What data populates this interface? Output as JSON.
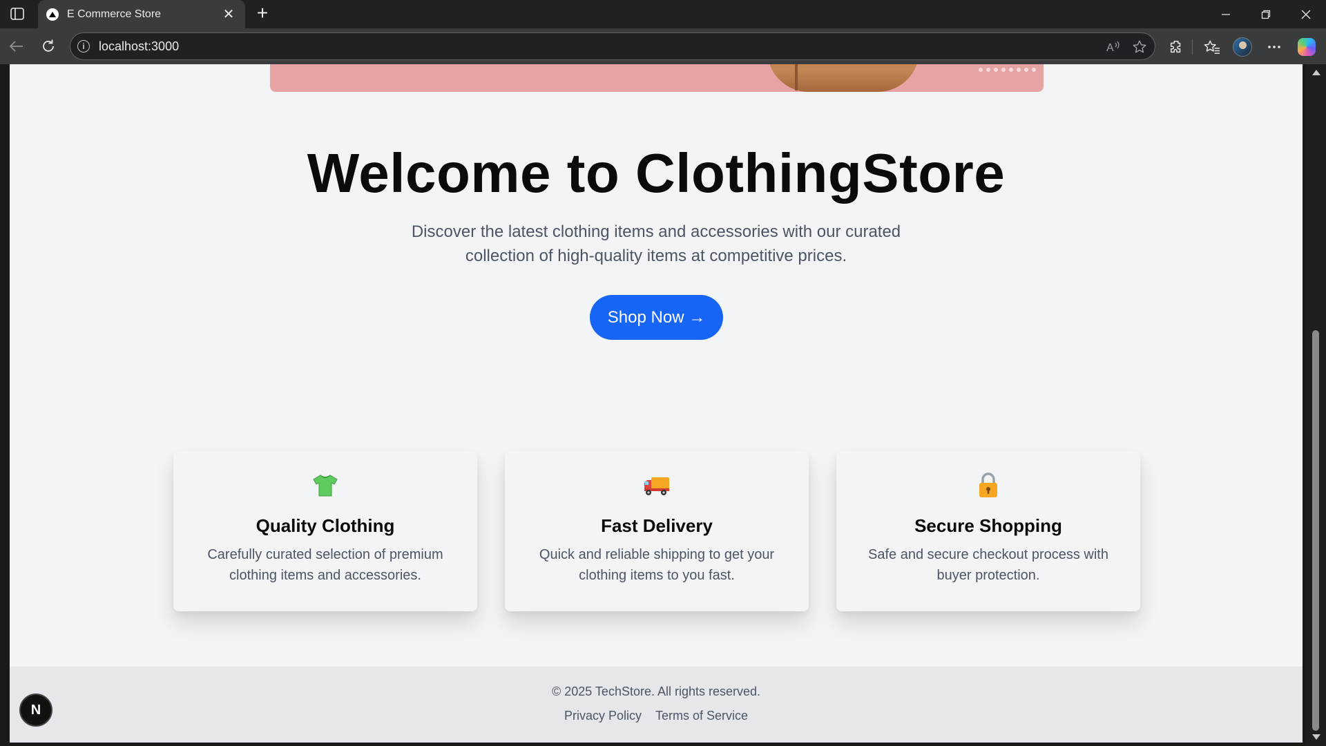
{
  "browser": {
    "tab_title": "E Commerce Store",
    "url": "localhost:3000"
  },
  "hero": {
    "title": "Welcome to ClothingStore",
    "subtitle": "Discover the latest clothing items and accessories with our curated collection of high-quality items at competitive prices.",
    "cta_label": "Shop Now →"
  },
  "features": [
    {
      "icon": "t-shirt-icon",
      "title": "Quality Clothing",
      "description": "Carefully curated selection of premium clothing items and accessories."
    },
    {
      "icon": "delivery-truck-icon",
      "title": "Fast Delivery",
      "description": "Quick and reliable shipping to get your clothing items to you fast."
    },
    {
      "icon": "lock-icon",
      "title": "Secure Shopping",
      "description": "Safe and secure checkout process with buyer protection."
    }
  ],
  "footer": {
    "copyright": "© 2025 TechStore. All rights reserved.",
    "links": [
      "Privacy Policy",
      "Terms of Service"
    ]
  },
  "badge": {
    "letter": "N"
  },
  "colors": {
    "primary": "#1765f5",
    "page_bg": "#f3f4f6",
    "footer_bg": "#e5e7eb",
    "banner_bg": "#e6a3a3",
    "text_muted": "#4b5563"
  }
}
